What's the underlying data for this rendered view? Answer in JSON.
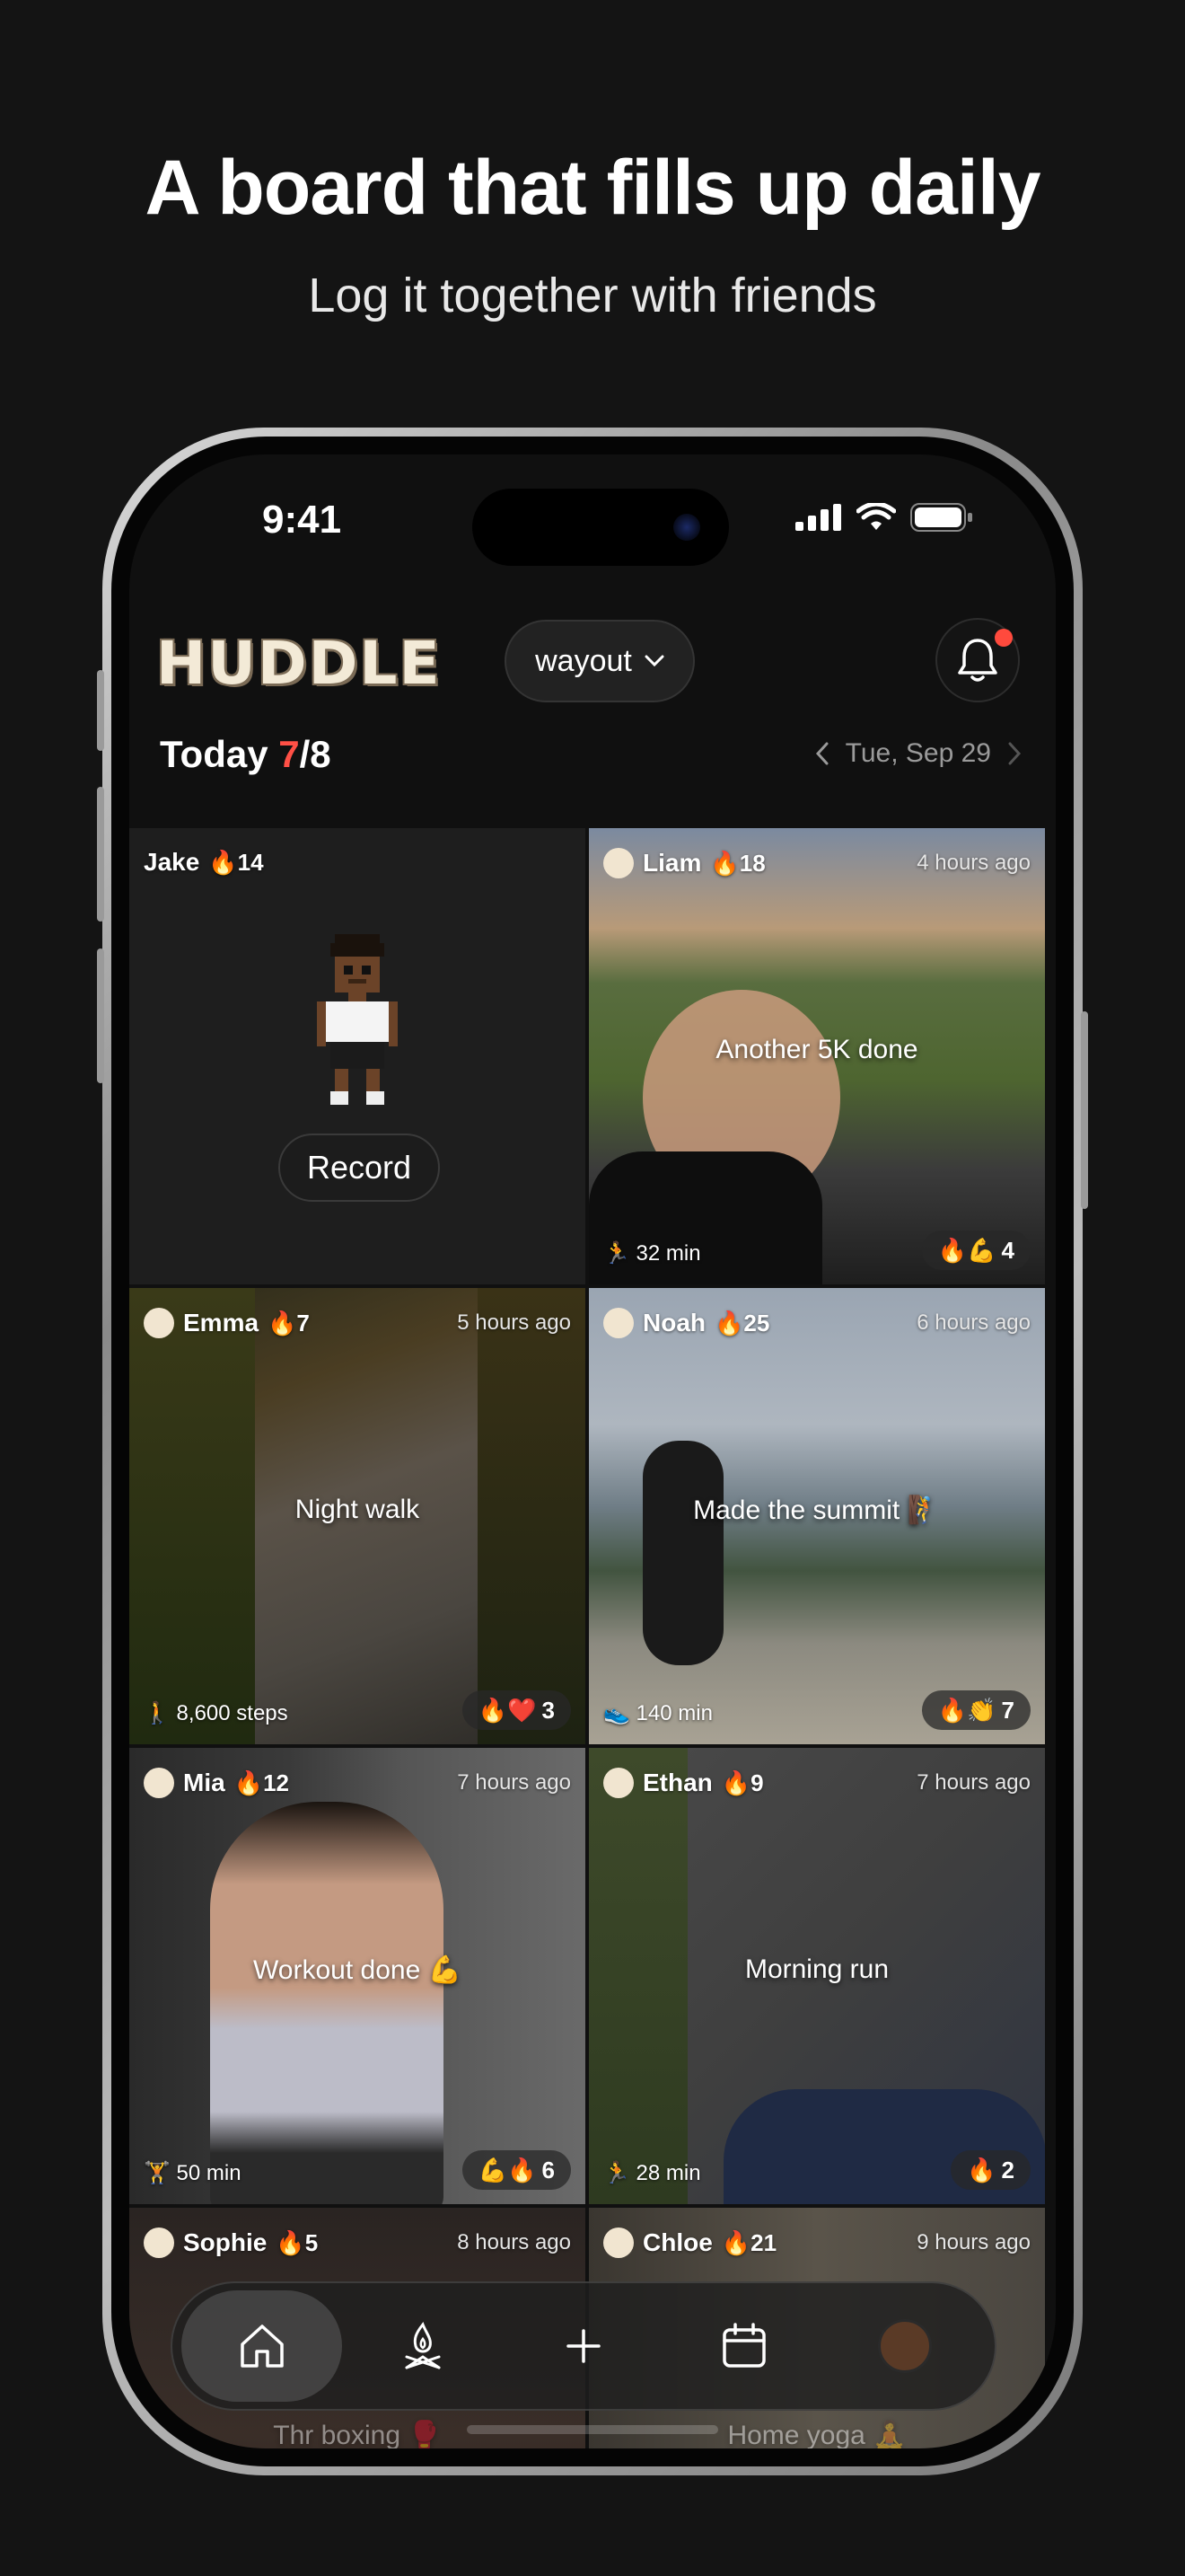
{
  "promo": {
    "headline": "A board that fills up daily",
    "subline": "Log it together with friends"
  },
  "status_bar": {
    "time": "9:41"
  },
  "header": {
    "logo": "HUDDLE",
    "group_name": "wayout",
    "notification_dot": true
  },
  "today": {
    "label": "Today",
    "done": "7",
    "total": "/8",
    "date": "Tue, Sep 29"
  },
  "cards": [
    {
      "name": "Jake",
      "streak": "14",
      "is_self": true,
      "record_label": "Record"
    },
    {
      "name": "Liam",
      "streak": "18",
      "ago": "4 hours ago",
      "caption": "Another 5K done",
      "metric": "🏃 32 min",
      "reactions": "🔥💪",
      "count": "4"
    },
    {
      "name": "Emma",
      "streak": "7",
      "ago": "5 hours ago",
      "caption": "Night walk",
      "metric": "🚶 8,600 steps",
      "reactions": "🔥❤️",
      "count": "3"
    },
    {
      "name": "Noah",
      "streak": "25",
      "ago": "6 hours ago",
      "caption": "Made the summit 🧗",
      "metric": "👟 140 min",
      "reactions": "🔥👏",
      "count": "7"
    },
    {
      "name": "Mia",
      "streak": "12",
      "ago": "7 hours ago",
      "caption": "Workout done 💪",
      "metric": "🏋 50 min",
      "reactions": "💪🔥",
      "count": "6"
    },
    {
      "name": "Ethan",
      "streak": "9",
      "ago": "7 hours ago",
      "caption": "Morning run",
      "metric": "🏃 28 min",
      "reactions": "🔥",
      "count": "2"
    },
    {
      "name": "Sophie",
      "streak": "5",
      "ago": "8 hours ago",
      "caption": "Thr boxing 🥊"
    },
    {
      "name": "Chloe",
      "streak": "21",
      "ago": "9 hours ago",
      "caption": "Home yoga 🧘"
    }
  ],
  "tabbar": {
    "tabs": [
      "home-icon",
      "campfire-icon",
      "plus-icon",
      "calendar-icon",
      "profile-avatar"
    ]
  },
  "colors": {
    "accent_red": "#ff5046",
    "background": "#141414"
  }
}
